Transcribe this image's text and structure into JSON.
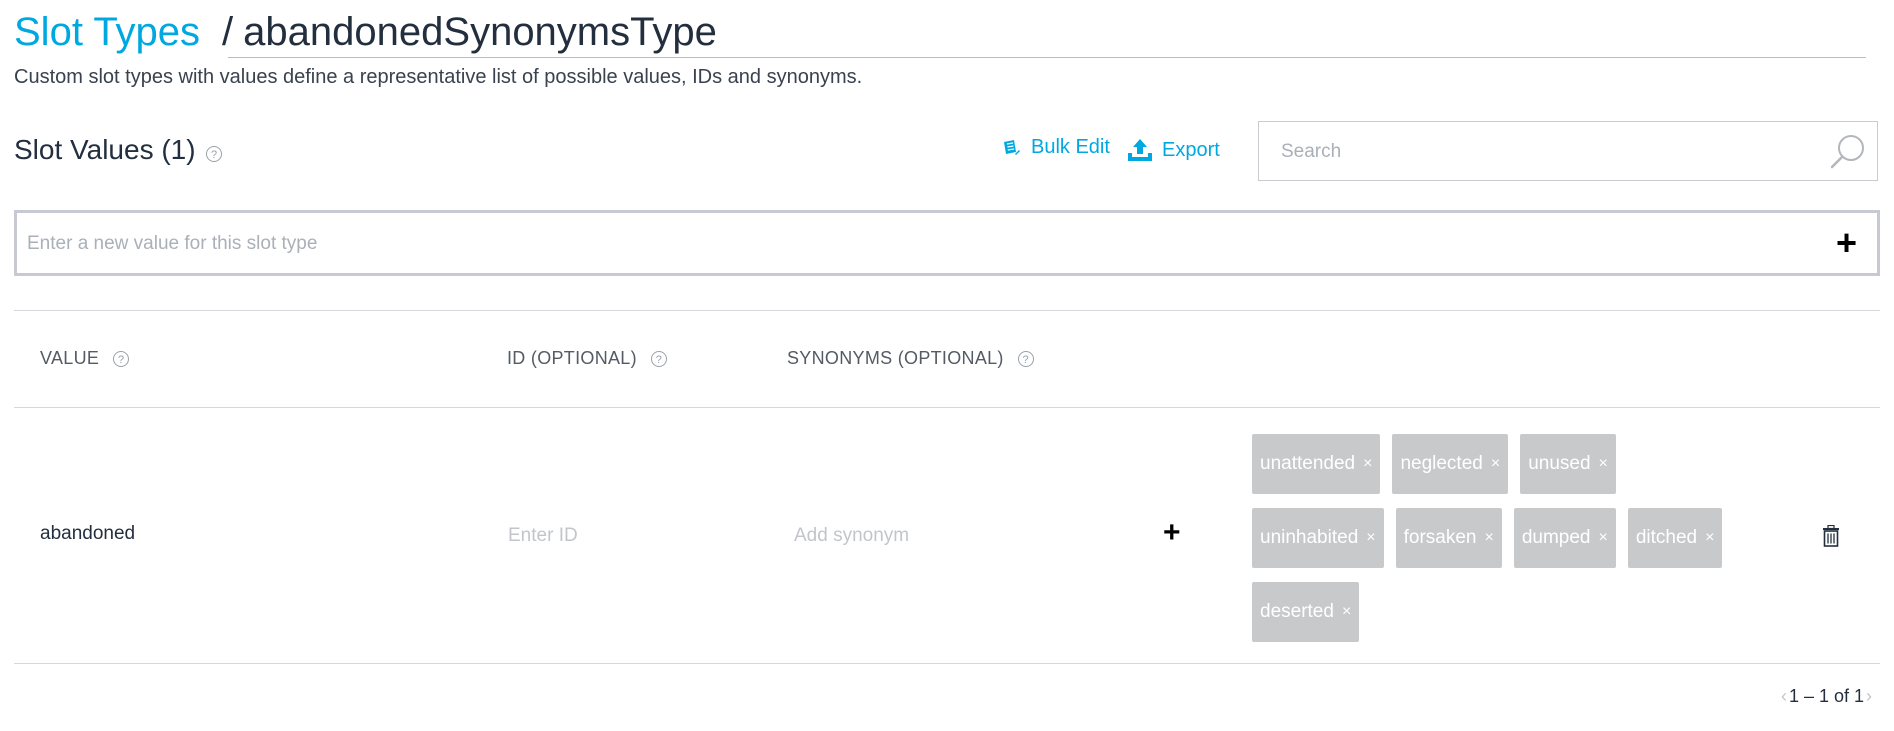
{
  "header": {
    "breadcrumb_link": "Slot Types",
    "separator": "/",
    "current": "abandonedSynonymsType",
    "subtitle": "Custom slot types with values define a representative list of possible values, IDs and synonyms."
  },
  "slot_values": {
    "title": "Slot Values (1)",
    "help": "?",
    "bulk_edit_label": "Bulk Edit",
    "export_label": "Export",
    "search_placeholder": "Search",
    "new_value_placeholder": "Enter a new value for this slot type",
    "add_symbol": "+"
  },
  "table": {
    "columns": [
      {
        "label": "VALUE",
        "help": "?"
      },
      {
        "label": "ID (OPTIONAL)",
        "help": "?"
      },
      {
        "label": "SYNONYMS (OPTIONAL)",
        "help": "?"
      }
    ],
    "row": {
      "value": "abandoned",
      "id_placeholder": "Enter ID",
      "synonym_placeholder": "Add synonym",
      "add_symbol": "+",
      "remove_symbol": "×",
      "synonyms": [
        "unattended",
        "neglected",
        "unused",
        "uninhabited",
        "forsaken",
        "dumped",
        "ditched",
        "deserted"
      ]
    }
  },
  "pagination": {
    "prev": "‹",
    "text": "1 – 1 of 1",
    "next": "›"
  },
  "colors": {
    "accent": "#00a8e1",
    "chip_bg": "#c8c9cb",
    "text": "#232f3e"
  }
}
